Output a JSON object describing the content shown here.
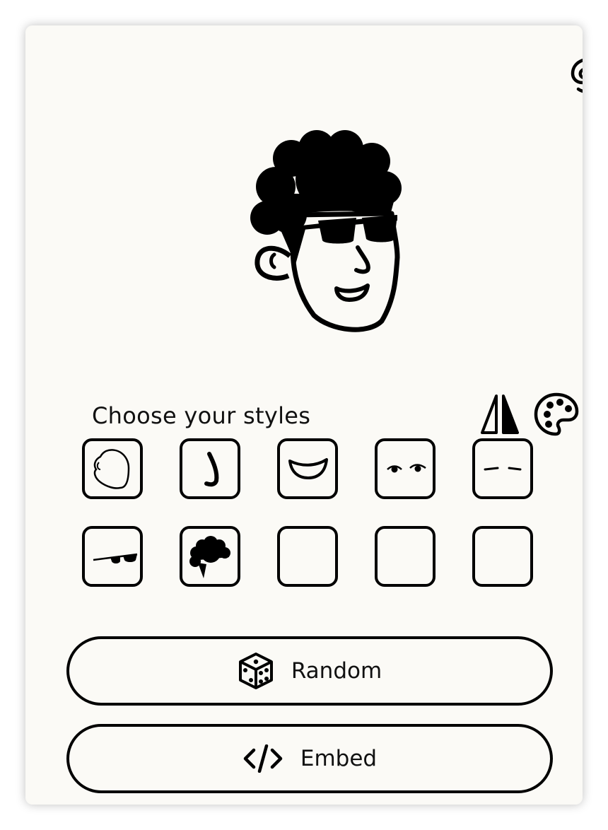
{
  "app": {
    "logo_icon": "spiral-logo-icon"
  },
  "avatar": {
    "icon": "face-with-curly-hair-and-sunglasses"
  },
  "styles_section": {
    "heading": "Choose your styles",
    "mirror_icon": "flip-horizontal-icon",
    "palette_icon": "color-palette-icon",
    "options": [
      {
        "name": "face",
        "icon": "face-shape-icon",
        "filled": true
      },
      {
        "name": "nose",
        "icon": "nose-icon",
        "filled": true
      },
      {
        "name": "mouth",
        "icon": "smile-mouth-icon",
        "filled": true
      },
      {
        "name": "eyes",
        "icon": "eyes-icon",
        "filled": true
      },
      {
        "name": "eyebrows",
        "icon": "eyebrows-icon",
        "filled": true
      },
      {
        "name": "glasses",
        "icon": "sunglasses-icon",
        "filled": true
      },
      {
        "name": "hair",
        "icon": "curly-hair-icon",
        "filled": true
      },
      {
        "name": "empty-1",
        "icon": "",
        "filled": false
      },
      {
        "name": "empty-2",
        "icon": "",
        "filled": false
      },
      {
        "name": "empty-3",
        "icon": "",
        "filled": false
      }
    ]
  },
  "actions": {
    "random_label": "Random",
    "random_icon": "dice-icon",
    "embed_label": "Embed",
    "embed_icon": "code-brackets-icon"
  },
  "colors": {
    "card_background": "#fbfaf6",
    "ink": "#000000"
  }
}
